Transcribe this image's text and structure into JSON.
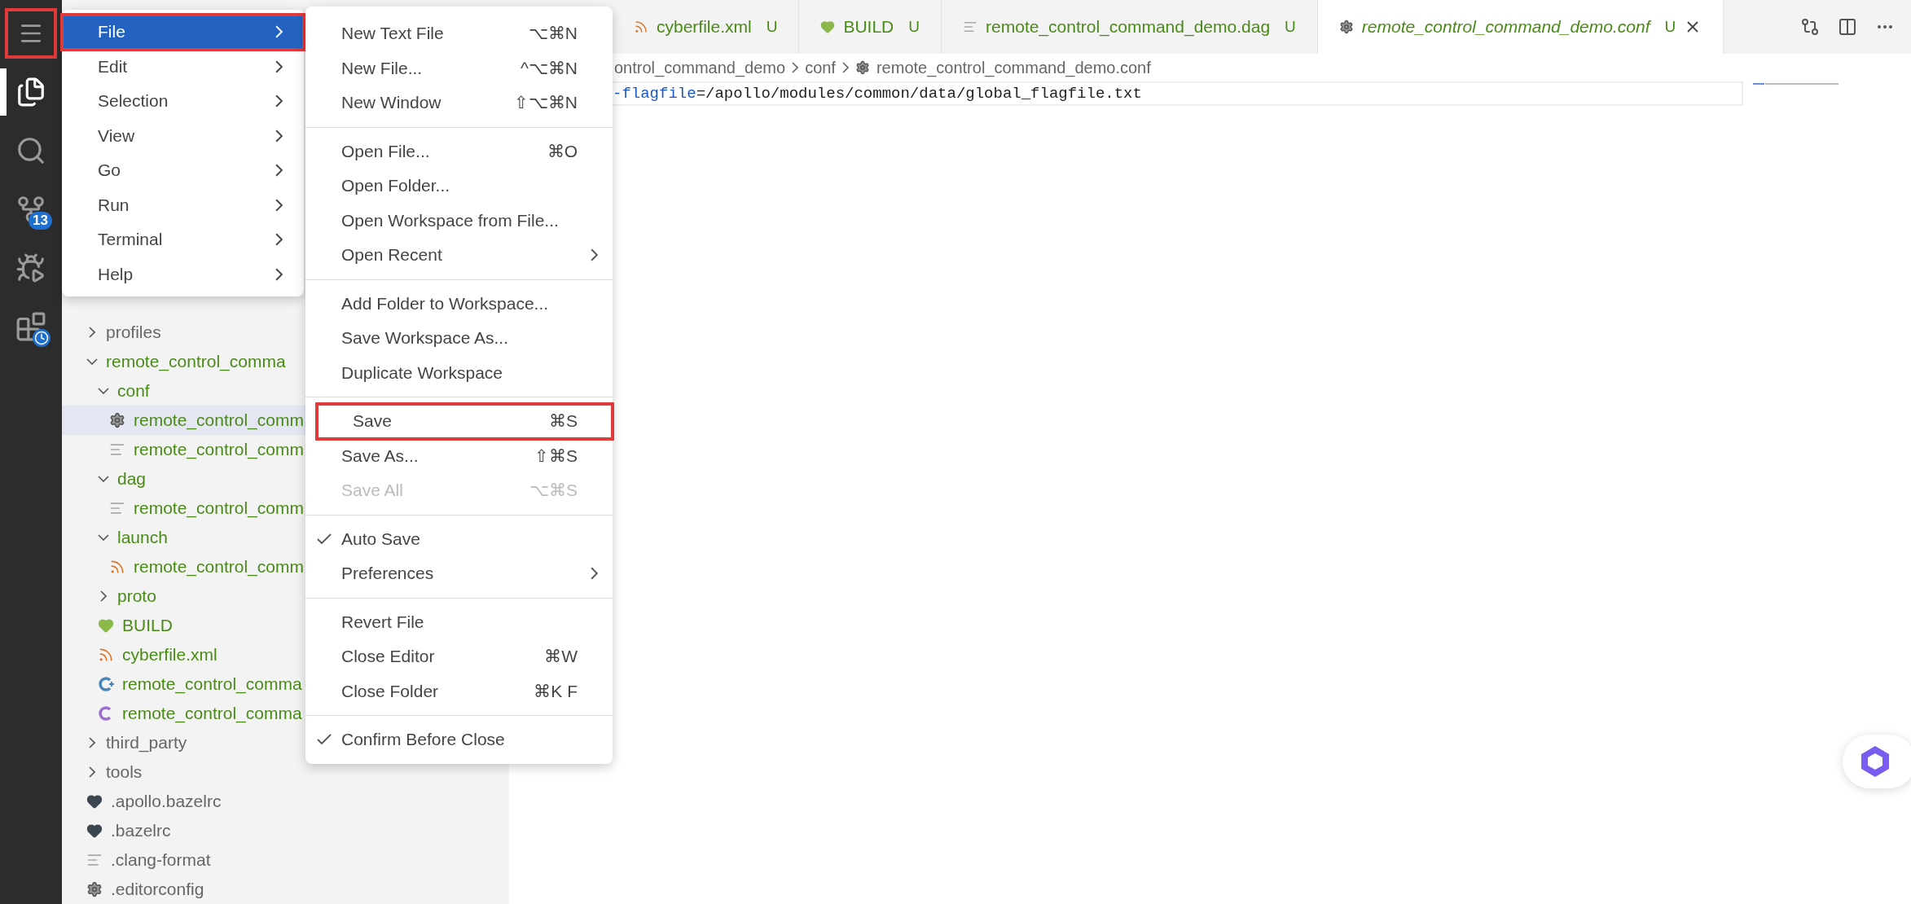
{
  "activity_bar": {
    "items": [
      {
        "kind": "menu",
        "selected": false,
        "highlighted": true
      },
      {
        "kind": "explorer",
        "selected": true,
        "highlighted": false
      },
      {
        "kind": "search",
        "selected": false,
        "highlighted": false
      },
      {
        "kind": "scm",
        "selected": false,
        "highlighted": false,
        "badge": "13"
      },
      {
        "kind": "run",
        "selected": false,
        "highlighted": false
      },
      {
        "kind": "extensions",
        "selected": false,
        "highlighted": false
      }
    ]
  },
  "sidebar": {
    "tree": [
      {
        "label": "profiles",
        "kind": "folder",
        "expanded": false,
        "untracked": false,
        "selected": false
      },
      {
        "label": "remote_control_comma",
        "kind": "folder",
        "expanded": true,
        "untracked": true,
        "selected": false,
        "children": [
          {
            "label": "conf",
            "kind": "folder",
            "expanded": true,
            "untracked": true,
            "selected": false,
            "children": [
              {
                "label": "remote_control_comm",
                "kind": "config",
                "untracked": true,
                "selected": true
              },
              {
                "label": "remote_control_comm",
                "kind": "text",
                "untracked": true,
                "selected": false
              }
            ]
          },
          {
            "label": "dag",
            "kind": "folder",
            "expanded": true,
            "untracked": true,
            "selected": false,
            "children": [
              {
                "label": "remote_control_comm",
                "kind": "text",
                "untracked": true,
                "selected": false
              }
            ]
          },
          {
            "label": "launch",
            "kind": "folder",
            "expanded": true,
            "untracked": true,
            "selected": false,
            "children": [
              {
                "label": "remote_control_comm",
                "kind": "feed",
                "untracked": true,
                "selected": false
              }
            ]
          },
          {
            "label": "proto",
            "kind": "folder",
            "expanded": false,
            "untracked": true,
            "selected": false
          },
          {
            "label": "BUILD",
            "kind": "build",
            "untracked": true,
            "selected": false
          },
          {
            "label": "cyberfile.xml",
            "kind": "feed",
            "untracked": true,
            "selected": false
          },
          {
            "label": "remote_control_comma",
            "kind": "cpp",
            "untracked": true,
            "selected": false
          },
          {
            "label": "remote_control_comma",
            "kind": "c",
            "untracked": true,
            "selected": false
          }
        ]
      },
      {
        "label": "third_party",
        "kind": "folder",
        "expanded": false,
        "untracked": false,
        "selected": false
      },
      {
        "label": "tools",
        "kind": "folder",
        "expanded": false,
        "untracked": false,
        "selected": false
      },
      {
        "label": ".apollo.bazelrc",
        "kind": "rc",
        "untracked": false,
        "selected": false
      },
      {
        "label": ".bazelrc",
        "kind": "rc",
        "untracked": false,
        "selected": false
      },
      {
        "label": ".clang-format",
        "kind": "text",
        "untracked": false,
        "selected": false
      },
      {
        "label": ".editorconfig",
        "kind": "config",
        "untracked": false,
        "selected": false
      }
    ]
  },
  "tabs": [
    {
      "label": "cyberfile.xml",
      "kind": "feed",
      "decoration": "U",
      "selected": false
    },
    {
      "label": "BUILD",
      "kind": "build",
      "decoration": "U",
      "selected": false
    },
    {
      "label": "remote_control_command_demo.dag",
      "kind": "text",
      "decoration": "U",
      "selected": false
    },
    {
      "label": "remote_control_command_demo.conf",
      "kind": "config",
      "decoration": "U",
      "selected": true
    }
  ],
  "breadcrumbs": [
    {
      "label": "ontrol_command_demo",
      "kind": "folder"
    },
    {
      "label": "conf",
      "kind": "folder"
    },
    {
      "label": "remote_control_command_demo.conf",
      "kind": "config"
    }
  ],
  "editor": {
    "lines": [
      {
        "key": "-flagfile",
        "value": "=/apollo/modules/common/data/global_flagfile.txt"
      }
    ]
  },
  "menu": {
    "items": [
      {
        "label": "File",
        "selected": true,
        "highlighted": true
      },
      {
        "label": "Edit",
        "selected": false,
        "highlighted": false
      },
      {
        "label": "Selection",
        "selected": false,
        "highlighted": false
      },
      {
        "label": "View",
        "selected": false,
        "highlighted": false
      },
      {
        "label": "Go",
        "selected": false,
        "highlighted": false
      },
      {
        "label": "Run",
        "selected": false,
        "highlighted": false
      },
      {
        "label": "Terminal",
        "selected": false,
        "highlighted": false
      },
      {
        "label": "Help",
        "selected": false,
        "highlighted": false
      }
    ]
  },
  "file_menu": {
    "groups": [
      [
        {
          "label": "New Text File",
          "shortcut": "⌥⌘N",
          "checked": false,
          "disabled": false,
          "submenu": false,
          "highlighted": false
        },
        {
          "label": "New File...",
          "shortcut": "^⌥⌘N",
          "checked": false,
          "disabled": false,
          "submenu": false,
          "highlighted": false
        },
        {
          "label": "New Window",
          "shortcut": "⇧⌥⌘N",
          "checked": false,
          "disabled": false,
          "submenu": false,
          "highlighted": false
        }
      ],
      [
        {
          "label": "Open File...",
          "shortcut": "⌘O",
          "checked": false,
          "disabled": false,
          "submenu": false,
          "highlighted": false
        },
        {
          "label": "Open Folder...",
          "checked": false,
          "disabled": false,
          "submenu": false,
          "highlighted": false
        },
        {
          "label": "Open Workspace from File...",
          "checked": false,
          "disabled": false,
          "submenu": false,
          "highlighted": false
        },
        {
          "label": "Open Recent",
          "checked": false,
          "disabled": false,
          "submenu": true,
          "highlighted": false
        }
      ],
      [
        {
          "label": "Add Folder to Workspace...",
          "checked": false,
          "disabled": false,
          "submenu": false,
          "highlighted": false
        },
        {
          "label": "Save Workspace As...",
          "checked": false,
          "disabled": false,
          "submenu": false,
          "highlighted": false
        },
        {
          "label": "Duplicate Workspace",
          "checked": false,
          "disabled": false,
          "submenu": false,
          "highlighted": false
        }
      ],
      [
        {
          "label": "Save",
          "shortcut": "⌘S",
          "checked": false,
          "disabled": false,
          "submenu": false,
          "highlighted": true
        },
        {
          "label": "Save As...",
          "shortcut": "⇧⌘S",
          "checked": false,
          "disabled": false,
          "submenu": false,
          "highlighted": false
        },
        {
          "label": "Save All",
          "shortcut": "⌥⌘S",
          "checked": false,
          "disabled": true,
          "submenu": false,
          "highlighted": false
        }
      ],
      [
        {
          "label": "Auto Save",
          "checked": true,
          "disabled": false,
          "submenu": false,
          "highlighted": false
        },
        {
          "label": "Preferences",
          "checked": false,
          "disabled": false,
          "submenu": true,
          "highlighted": false
        }
      ],
      [
        {
          "label": "Revert File",
          "checked": false,
          "disabled": false,
          "submenu": false,
          "highlighted": false
        },
        {
          "label": "Close Editor",
          "shortcut": "⌘W",
          "checked": false,
          "disabled": false,
          "submenu": false,
          "highlighted": false
        },
        {
          "label": "Close Folder",
          "shortcut": "⌘K F",
          "checked": false,
          "disabled": false,
          "submenu": false,
          "highlighted": false
        }
      ],
      [
        {
          "label": "Confirm Before Close",
          "checked": true,
          "disabled": false,
          "submenu": false,
          "highlighted": false
        }
      ]
    ]
  }
}
